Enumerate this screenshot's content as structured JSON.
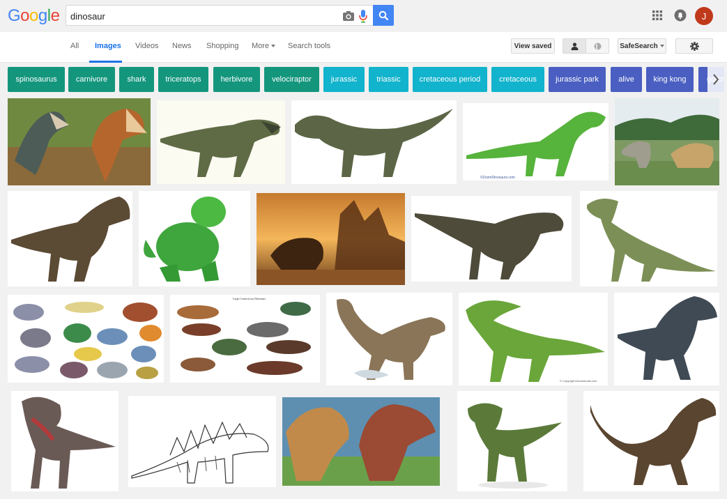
{
  "logo": {
    "letters": [
      "G",
      "o",
      "o",
      "g",
      "l",
      "e"
    ],
    "colors": [
      "#4285f4",
      "#ea4335",
      "#fbbc05",
      "#4285f4",
      "#34a853",
      "#ea4335"
    ]
  },
  "search": {
    "query": "dinosaur"
  },
  "account": {
    "initial": "J",
    "color": "#c0391b"
  },
  "tabs": {
    "all": "All",
    "images": "Images",
    "videos": "Videos",
    "news": "News",
    "shopping": "Shopping",
    "more": "More",
    "search_tools": "Search tools"
  },
  "tools": {
    "view_saved": "View saved",
    "safesearch": "SafeSearch"
  },
  "chips": [
    {
      "label": "spinosaurus",
      "color": "#14967d"
    },
    {
      "label": "carnivore",
      "color": "#14967d"
    },
    {
      "label": "shark",
      "color": "#14967d"
    },
    {
      "label": "triceratops",
      "color": "#14967d"
    },
    {
      "label": "herbivore",
      "color": "#14967d"
    },
    {
      "label": "velociraptor",
      "color": "#14967d"
    },
    {
      "label": "jurassic",
      "color": "#12b3cc"
    },
    {
      "label": "triassic",
      "color": "#12b3cc"
    },
    {
      "label": "cretaceous period",
      "color": "#12b3cc"
    },
    {
      "label": "cretaceous",
      "color": "#12b3cc"
    },
    {
      "label": "jurassic park",
      "color": "#4a5fc1"
    },
    {
      "label": "alive",
      "color": "#4a5fc1"
    },
    {
      "label": "king kong",
      "color": "#4a5fc1"
    },
    {
      "label": "godzilla",
      "color": "#4a5fc1"
    }
  ],
  "image_captions": {
    "zoom_credit": "©ZoomDinosaurs.com",
    "copyright_credit": "© Copyright DinoAnimals.com",
    "chart_title": "Large Carnivorous Dinosaurs"
  },
  "colors": {
    "accent_blue": "#4285f4",
    "active_tab": "#1a73e8",
    "teal": "#14967d",
    "cyan": "#12b3cc",
    "indigo": "#4a5fc1"
  }
}
